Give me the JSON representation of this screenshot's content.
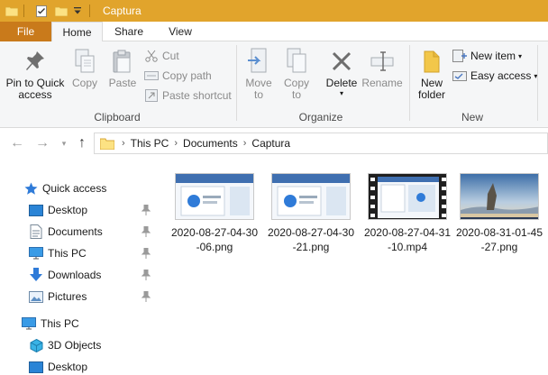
{
  "window": {
    "title": "Captura",
    "accent": "#e1a42c"
  },
  "ribbon_tabs": {
    "file": "File",
    "home": "Home",
    "share": "Share",
    "view": "View"
  },
  "ribbon": {
    "clipboard": {
      "label": "Clipboard",
      "pin_line1": "Pin to Quick",
      "pin_line2": "access",
      "copy": "Copy",
      "paste": "Paste",
      "cut": "Cut",
      "copy_path": "Copy path",
      "paste_shortcut": "Paste shortcut"
    },
    "organize": {
      "label": "Organize",
      "move_to_line1": "Move",
      "move_to_line2": "to",
      "copy_to_line1": "Copy",
      "copy_to_line2": "to",
      "delete": "Delete",
      "rename": "Rename"
    },
    "new": {
      "label": "New",
      "new_folder_line1": "New",
      "new_folder_line2": "folder",
      "new_item": "New item",
      "easy_access": "Easy access"
    }
  },
  "address": {
    "crumbs": [
      "This PC",
      "Documents",
      "Captura"
    ]
  },
  "navigation": {
    "items": [
      {
        "label": "Quick access",
        "icon": "star-icon"
      },
      {
        "label": "Desktop",
        "icon": "desktop-icon",
        "pinned": true
      },
      {
        "label": "Documents",
        "icon": "documents-icon",
        "pinned": true
      },
      {
        "label": "This PC",
        "icon": "pc-icon",
        "pinned": true
      },
      {
        "label": "Downloads",
        "icon": "download-icon",
        "pinned": true
      },
      {
        "label": "Pictures",
        "icon": "pictures-icon",
        "pinned": true
      },
      {
        "label": "This PC",
        "icon": "pc-icon"
      },
      {
        "label": "3D Objects",
        "icon": "cube-icon"
      },
      {
        "label": "Desktop",
        "icon": "desktop-icon"
      }
    ]
  },
  "files": [
    {
      "line1": "2020-08-27-04-30",
      "line2": "-06.png",
      "kind": "screenshot"
    },
    {
      "line1": "2020-08-27-04-30",
      "line2": "-21.png",
      "kind": "screenshot"
    },
    {
      "line1": "2020-08-27-04-31",
      "line2": "-10.mp4",
      "kind": "video"
    },
    {
      "line1": "2020-08-31-01-45",
      "line2": "-27.png",
      "kind": "landscape"
    }
  ]
}
